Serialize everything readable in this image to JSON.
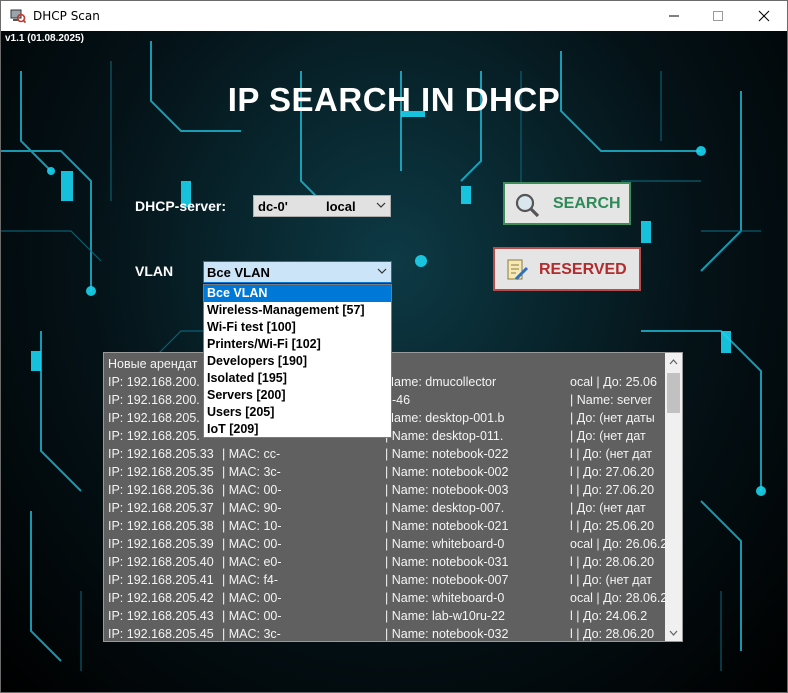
{
  "window": {
    "title": "DHCP Scan",
    "version": "v1.1 (01.08.2025)"
  },
  "heading": "IP SEARCH IN DHCP",
  "dhcp_server": {
    "label": "DHCP-server:",
    "value_left": "dc-0'",
    "value_right": "local"
  },
  "vlan": {
    "label": "VLAN",
    "selected": "Все VLAN",
    "options": [
      "Все VLAN",
      "Wireless-Management [57]",
      "Wi-Fi test [100]",
      "Printers/Wi-Fi [102]",
      "Developers [190]",
      "Isolated [195]",
      "Servers [200]",
      "Users [205]",
      "IoT [209]"
    ]
  },
  "buttons": {
    "search": "SEARCH",
    "reserved": "RESERVED"
  },
  "results": {
    "header": "Новые арендат",
    "rows": [
      {
        "ip": "IP: 192.168.200.",
        "mac": "",
        "name": "Name: dmucollector",
        "extra": "ocal | До: 25.06"
      },
      {
        "ip": "IP: 192.168.200.",
        "mac": "",
        "name": "4-46",
        "extra": "| Name: server"
      },
      {
        "ip": "IP: 192.168.205.",
        "mac": "",
        "name": "Name: desktop-001.b",
        "extra": "| До: (нет даты"
      },
      {
        "ip": "IP: 192.168.205.",
        "mac": "",
        "name": "| Name: desktop-011.",
        "extra": "| До: (нет дат"
      },
      {
        "ip": "IP: 192.168.205.33",
        "mac": "| MAC: cc-",
        "name": "| Name: notebook-022",
        "extra": "l | До: (нет дат"
      },
      {
        "ip": "IP: 192.168.205.35",
        "mac": "| MAC: 3c-",
        "name": "| Name: notebook-002",
        "extra": "l | До: 27.06.20"
      },
      {
        "ip": "IP: 192.168.205.36",
        "mac": "| MAC: 00-",
        "name": "| Name: notebook-003",
        "extra": "l | До: 27.06.20"
      },
      {
        "ip": "IP: 192.168.205.37",
        "mac": "| MAC: 90-",
        "name": "| Name: desktop-007.",
        "extra": "| До: (нет дат"
      },
      {
        "ip": "IP: 192.168.205.38",
        "mac": "| MAC: 10-",
        "name": "| Name: notebook-021",
        "extra": "l | До: 25.06.20"
      },
      {
        "ip": "IP: 192.168.205.39",
        "mac": "| MAC: 00-",
        "name": "| Name: whiteboard-0",
        "extra": "ocal | До: 26.06.2"
      },
      {
        "ip": "IP: 192.168.205.40",
        "mac": "| MAC: e0-",
        "name": "| Name: notebook-031",
        "extra": "l | До: 28.06.20"
      },
      {
        "ip": "IP: 192.168.205.41",
        "mac": "| MAC: f4-",
        "name": "| Name: notebook-007",
        "extra": "l | До: (нет дат"
      },
      {
        "ip": "IP: 192.168.205.42",
        "mac": "| MAC: 00-",
        "name": "| Name: whiteboard-0",
        "extra": "ocal | До: 28.06.2"
      },
      {
        "ip": "IP: 192.168.205.43",
        "mac": "| MAC: 00-",
        "name": "| Name: lab-w10ru-22",
        "extra": "l | До: 24.06.2"
      },
      {
        "ip": "IP: 192.168.205.45",
        "mac": "| MAC: 3c-",
        "name": "| Name: notebook-032",
        "extra": "l | До: 28.06.20"
      }
    ]
  },
  "colors": {
    "search_accent": "#2f8a57",
    "reserved_accent": "#b22c2c",
    "selection": "#0078d7"
  },
  "icons": {
    "search": "magnifier-icon",
    "reserved": "document-pen-icon"
  }
}
